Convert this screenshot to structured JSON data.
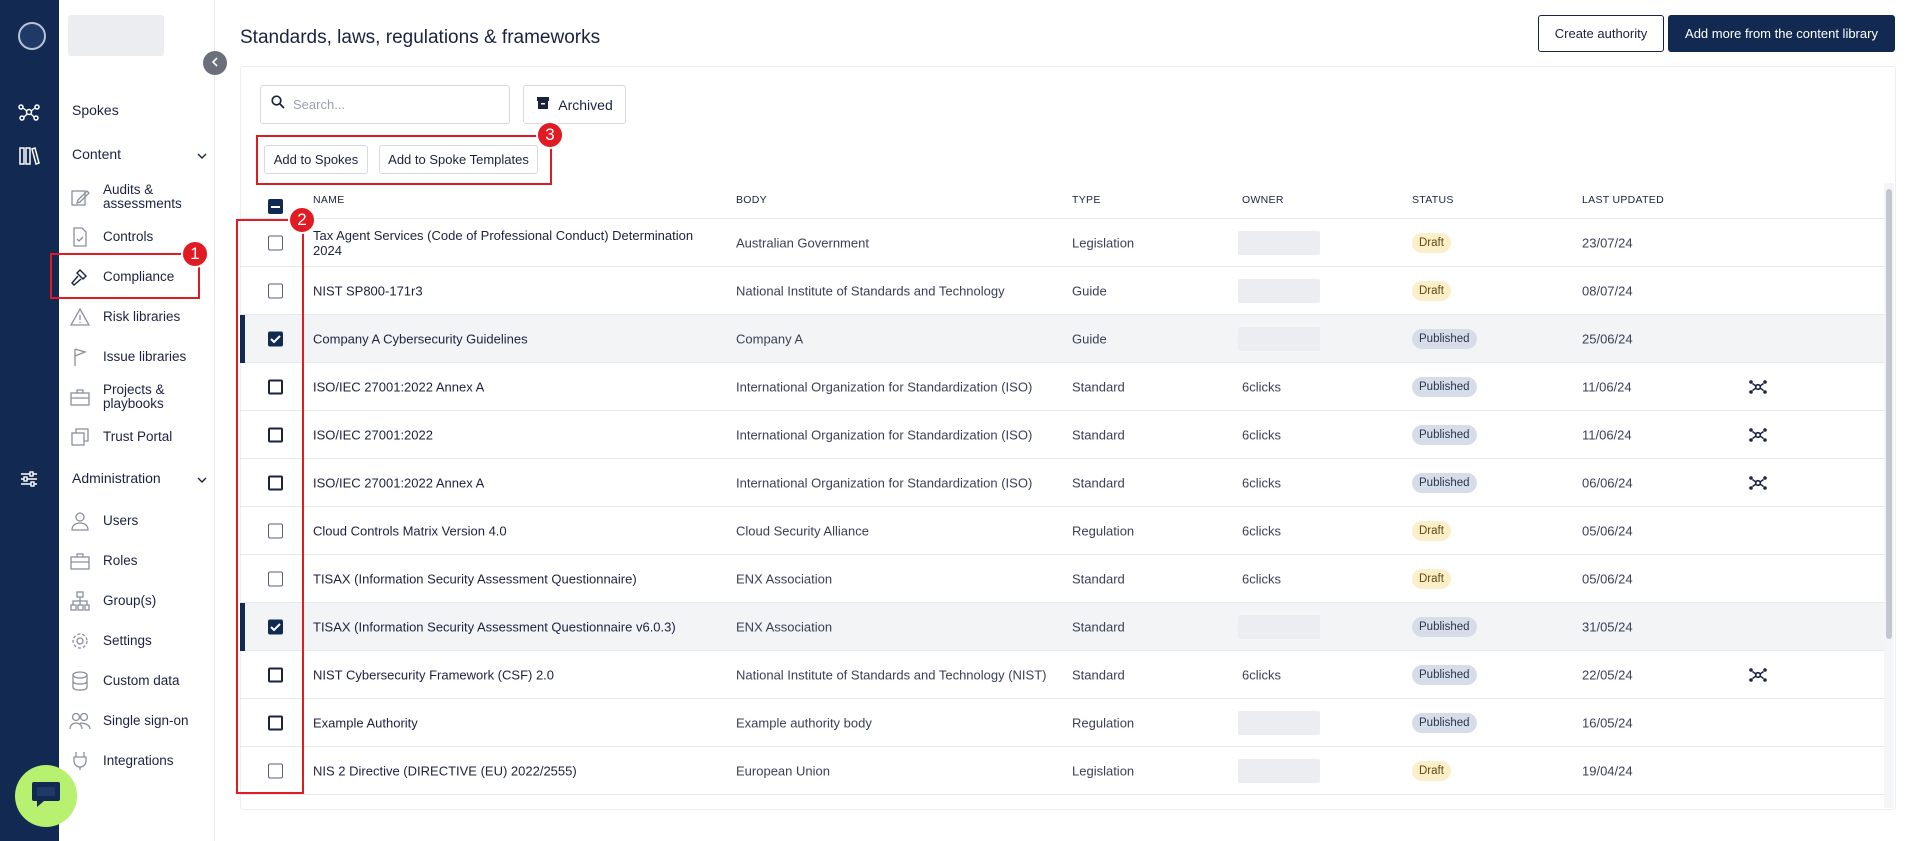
{
  "sidebar": {
    "spokes_label": "Spokes",
    "content_section": "Content",
    "content_items": [
      {
        "label": "Audits & assessments",
        "icon": "edit-icon"
      },
      {
        "label": "Controls",
        "icon": "document-check-icon"
      },
      {
        "label": "Compliance",
        "icon": "gavel-icon"
      },
      {
        "label": "Risk libraries",
        "icon": "warning-icon"
      },
      {
        "label": "Issue libraries",
        "icon": "flag-icon"
      },
      {
        "label": "Projects & playbooks",
        "icon": "briefcase-icon"
      },
      {
        "label": "Trust Portal",
        "icon": "portal-icon"
      }
    ],
    "admin_section": "Administration",
    "admin_items": [
      {
        "label": "Users",
        "icon": "user-icon"
      },
      {
        "label": "Roles",
        "icon": "roles-icon"
      },
      {
        "label": "Group(s)",
        "icon": "hierarchy-icon"
      },
      {
        "label": "Settings",
        "icon": "gear-icon"
      },
      {
        "label": "Custom data",
        "icon": "database-icon"
      },
      {
        "label": "Single sign-on",
        "icon": "users-icon"
      },
      {
        "label": "Integrations",
        "icon": "plug-icon"
      }
    ]
  },
  "header": {
    "title": "Standards, laws, regulations & frameworks",
    "create_label": "Create authority",
    "add_library_label": "Add more from the content library"
  },
  "toolbar": {
    "search_placeholder": "Search...",
    "archived_label": "Archived",
    "add_spokes_label": "Add to Spokes",
    "add_templates_label": "Add to Spoke Templates"
  },
  "table": {
    "columns": [
      "NAME",
      "BODY",
      "TYPE",
      "OWNER",
      "STATUS",
      "LAST UPDATED"
    ],
    "rows": [
      {
        "name": "Tax Agent Services (Code of Professional Conduct) Determination 2024",
        "body": "Australian Government",
        "type": "Legislation",
        "owner": "",
        "status": "Draft",
        "updated": "23/07/24",
        "checked": false,
        "dark": false,
        "spoke": false
      },
      {
        "name": "NIST SP800-171r3",
        "body": "National Institute of Standards and Technology",
        "type": "Guide",
        "owner": "",
        "status": "Draft",
        "updated": "08/07/24",
        "checked": false,
        "dark": false,
        "spoke": false
      },
      {
        "name": "Company A Cybersecurity Guidelines",
        "body": "Company A",
        "type": "Guide",
        "owner": "",
        "status": "Published",
        "updated": "25/06/24",
        "checked": true,
        "dark": true,
        "spoke": false
      },
      {
        "name": "ISO/IEC 27001:2022 Annex A",
        "body": "International Organization for Standardization (ISO)",
        "type": "Standard",
        "owner": "6clicks",
        "status": "Published",
        "updated": "11/06/24",
        "checked": false,
        "dark": true,
        "spoke": true
      },
      {
        "name": "ISO/IEC 27001:2022",
        "body": "International Organization for Standardization (ISO)",
        "type": "Standard",
        "owner": "6clicks",
        "status": "Published",
        "updated": "11/06/24",
        "checked": false,
        "dark": true,
        "spoke": true
      },
      {
        "name": "ISO/IEC 27001:2022 Annex A",
        "body": "International Organization for Standardization (ISO)",
        "type": "Standard",
        "owner": "6clicks",
        "status": "Published",
        "updated": "06/06/24",
        "checked": false,
        "dark": true,
        "spoke": true
      },
      {
        "name": "Cloud Controls Matrix Version 4.0",
        "body": "Cloud Security Alliance",
        "type": "Regulation",
        "owner": "6clicks",
        "status": "Draft",
        "updated": "05/06/24",
        "checked": false,
        "dark": false,
        "spoke": false
      },
      {
        "name": "TISAX (Information Security Assessment Questionnaire)",
        "body": "ENX Association",
        "type": "Standard",
        "owner": "6clicks",
        "status": "Draft",
        "updated": "05/06/24",
        "checked": false,
        "dark": false,
        "spoke": false
      },
      {
        "name": "TISAX (Information Security Assessment Questionnaire v6.0.3)",
        "body": "ENX Association",
        "type": "Standard",
        "owner": "",
        "status": "Published",
        "updated": "31/05/24",
        "checked": true,
        "dark": true,
        "spoke": false
      },
      {
        "name": "NIST Cybersecurity Framework (CSF) 2.0",
        "body": "National Institute of Standards and Technology (NIST)",
        "type": "Standard",
        "owner": "6clicks",
        "status": "Published",
        "updated": "22/05/24",
        "checked": false,
        "dark": true,
        "spoke": true
      },
      {
        "name": "Example Authority",
        "body": "Example authority body",
        "type": "Regulation",
        "owner": "",
        "status": "Published",
        "updated": "16/05/24",
        "checked": false,
        "dark": true,
        "spoke": false
      },
      {
        "name": "NIS 2 Directive (DIRECTIVE (EU) 2022/2555)",
        "body": "European Union",
        "type": "Legislation",
        "owner": "",
        "status": "Draft",
        "updated": "19/04/24",
        "checked": false,
        "dark": false,
        "spoke": false
      }
    ]
  },
  "annotations": [
    "1",
    "2",
    "3"
  ],
  "colors": {
    "navy": "#122a52",
    "annotation_red": "#e01b24",
    "draft_badge": "#fbefc9",
    "published_badge": "#d7dde8",
    "chat_green": "#b8f070"
  }
}
